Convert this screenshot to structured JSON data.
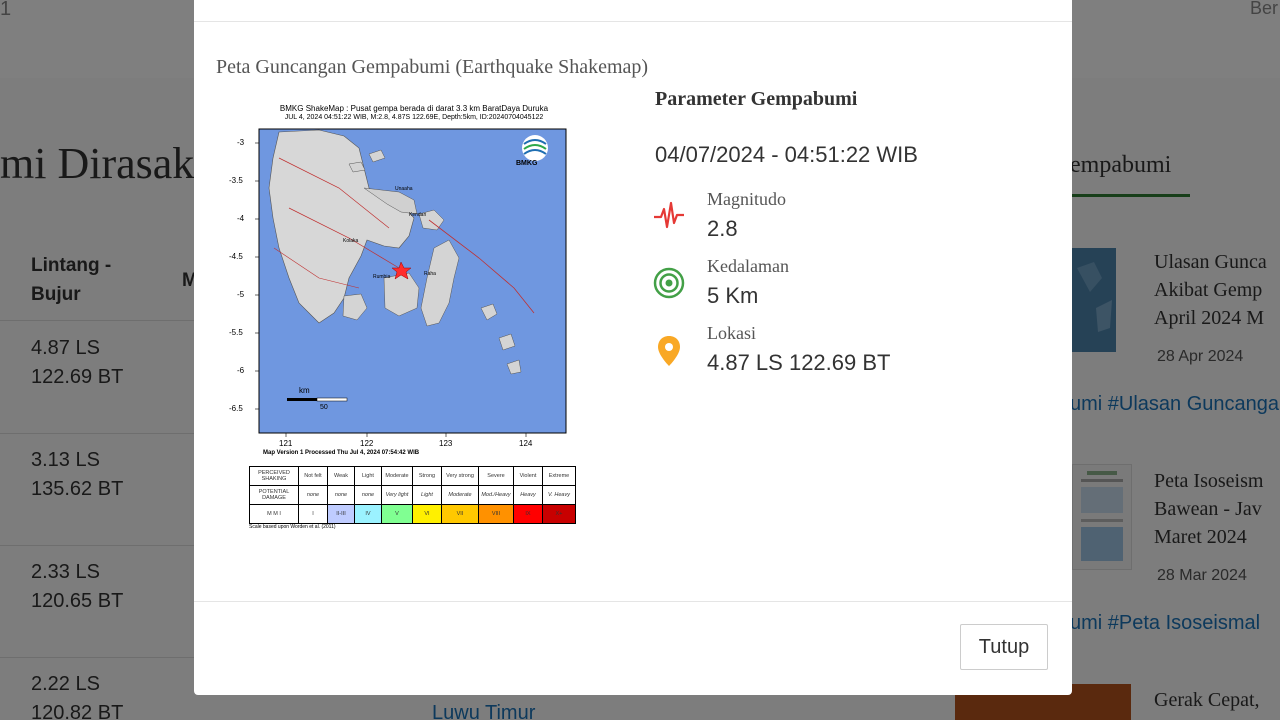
{
  "background": {
    "top_left_text": "1",
    "top_right_text": "Ber",
    "heading": "mi Dirasak",
    "column_header": [
      "Lintang -",
      "Bujur"
    ],
    "column_header_2": "M",
    "rows": [
      {
        "lat": "4.87 LS",
        "lon": "122.69 BT"
      },
      {
        "lat": "3.13 LS",
        "lon": "135.62 BT"
      },
      {
        "lat": "2.33 LS",
        "lon": "120.65 BT"
      },
      {
        "lat": "2.22 LS",
        "lon": "120.82 BT"
      }
    ],
    "bottom_link": "Luwu Timur",
    "tab": "empabumi",
    "news": [
      {
        "title": [
          "Ulasan Gunca",
          "Akibat Gemp",
          "April 2024 M"
        ],
        "date": "28 Apr 2024",
        "tags": "umi #Ulasan Guncanga"
      },
      {
        "title": [
          "Peta Isoseism",
          "Bawean - Jav",
          "Maret 2024"
        ],
        "date": "28 Mar 2024",
        "tags": "umi #Peta Isoseismal"
      },
      {
        "title": [
          "Gerak Cepat,"
        ]
      }
    ]
  },
  "modal": {
    "title": "Peta Guncangan Gempabumi (Earthquake Shakemap)",
    "shakemap": {
      "title_line1": "BMKG ShakeMap : Pusat gempa berada di darat 3.3 km BaratDaya Duruka",
      "title_line2": "JUL 4, 2024 04:51:22 WIB, M:2.8, 4.87S 122.69E, Depth:5km, ID:20240704045122",
      "logo_text": "BMKG",
      "y_ticks": [
        "-3",
        "-3.5",
        "-4",
        "-4.5",
        "-5",
        "-5.5",
        "-6",
        "-6.5"
      ],
      "x_ticks": [
        "121",
        "122",
        "123",
        "124"
      ],
      "scale_label": "km",
      "scale_value": "50",
      "places": [
        "Unaaha",
        "Kendari",
        "Kolaka",
        "Rumbia",
        "Raha"
      ],
      "version_text": "Map Version 1 Processed Thu Jul  4, 2024 07:54:42 WIB",
      "mmi_table": {
        "row_labels": [
          "PERCEIVED SHAKING",
          "POTENTIAL DAMAGE",
          "M M I"
        ],
        "shaking": [
          "Not felt",
          "Weak",
          "Light",
          "Moderate",
          "Strong",
          "Very strong",
          "Severe",
          "Violent",
          "Extreme"
        ],
        "damage": [
          "none",
          "none",
          "none",
          "Very light",
          "Light",
          "Moderate",
          "Mod./Heavy",
          "Heavy",
          "V. Heavy"
        ],
        "mmi": [
          "I",
          "II-III",
          "IV",
          "V",
          "VI",
          "VII",
          "VIII",
          "IX",
          "X+"
        ],
        "colors": [
          "#ffffff",
          "#bfccff",
          "#9bf2ff",
          "#80ff92",
          "#fff000",
          "#ffc800",
          "#ff9100",
          "#ff0000",
          "#c80000"
        ]
      },
      "footnote": "Scale based upon Worden et al. (2011)"
    },
    "params": {
      "heading": "Parameter Gempabumi",
      "datetime": "04/07/2024 - 04:51:22 WIB",
      "magnitude": {
        "label": "Magnitudo",
        "value": "2.8",
        "icon": "seismograph-icon",
        "color": "#e53935"
      },
      "depth": {
        "label": "Kedalaman",
        "value": "5 Km",
        "icon": "depth-rings-icon",
        "color": "#43a047"
      },
      "location": {
        "label": "Lokasi",
        "value": "4.87 LS 122.69 BT",
        "icon": "location-pin-icon",
        "color": "#f9a825"
      }
    },
    "close_label": "Tutup"
  }
}
